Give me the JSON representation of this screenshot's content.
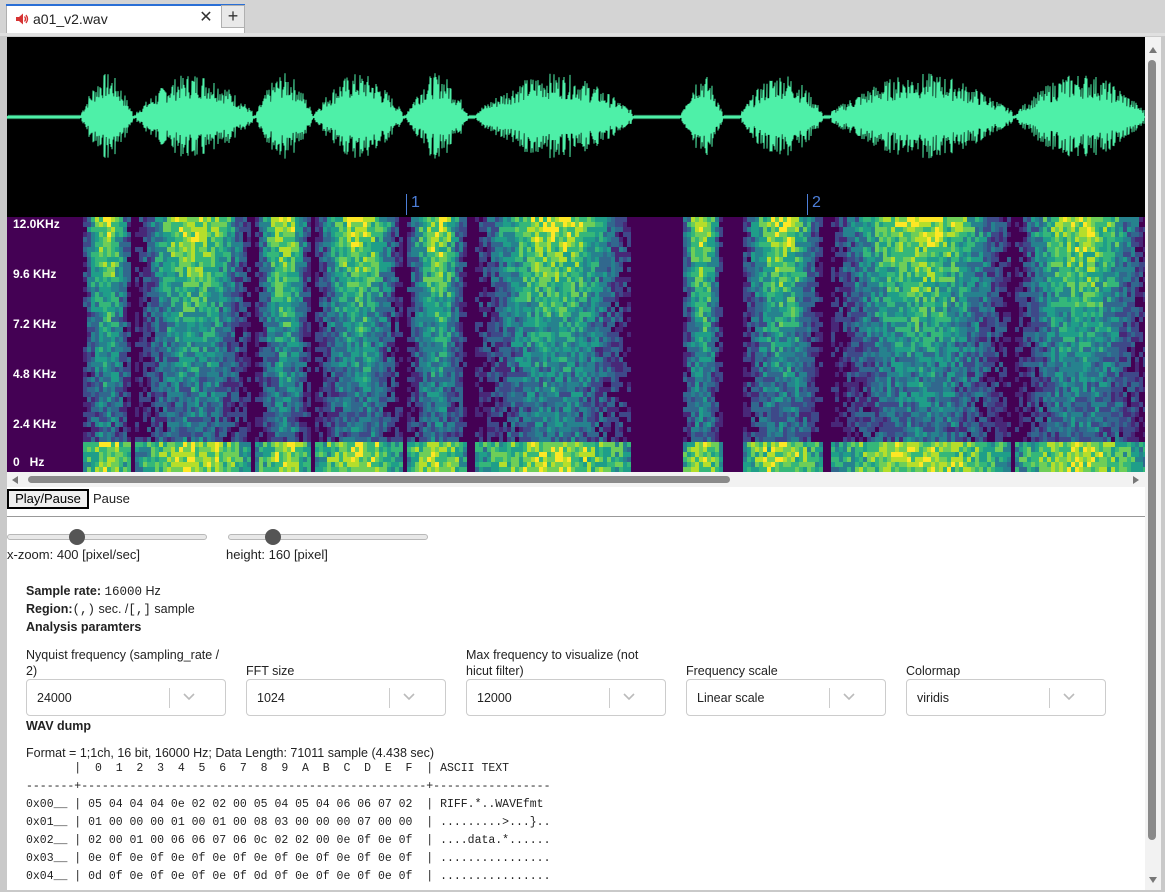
{
  "tab": {
    "title": "a01_v2.wav",
    "close": "✕",
    "new_tab": "+"
  },
  "wave": {
    "markers": [
      "1",
      "2"
    ],
    "color": "#4ef0a8"
  },
  "spectrogram": {
    "freq_labels": [
      "12.0KHz",
      "9.6 KHz",
      "7.2 KHz",
      "4.8 KHz",
      "2.4 KHz",
      "0   Hz"
    ],
    "colormap": "viridis"
  },
  "controls": {
    "play_pause": "Play/Pause",
    "status": "Pause",
    "xzoom_label": "x-zoom: 400 [pixel/sec]",
    "height_label": "height: 160 [pixel]",
    "xzoom_value": 400,
    "height_value": 160
  },
  "info": {
    "sample_rate_label": "Sample rate:",
    "sample_rate_value": "16000",
    "sample_rate_unit": "Hz",
    "region_label": "Region:",
    "region_sec": "(,)",
    "region_sec_unit": "sec. /",
    "region_sample": "[,]",
    "region_sample_unit": "sample",
    "analysis_heading": "Analysis paramters"
  },
  "params": [
    {
      "label": "Nyquist frequency (sampling_rate / 2)",
      "value": "24000"
    },
    {
      "label": "FFT size",
      "value": "1024"
    },
    {
      "label": "Max frequency to visualize (not hicut filter)",
      "value": "12000"
    },
    {
      "label": "Frequency scale",
      "value": "Linear scale"
    },
    {
      "label": "Colormap",
      "value": "viridis"
    }
  ],
  "dump": {
    "heading": "WAV dump",
    "format": "Format = 1;1ch, 16 bit, 16000 Hz; Data Length: 71011 sample (4.438 sec)",
    "header_row": "       |  0  1  2  3  4  5  6  7  8  9  A  B  C  D  E  F  | ASCII TEXT",
    "separator": "-------+--------------------------------------------------+-----------------",
    "rows": [
      "0x00__ | 05 04 04 04 0e 02 02 00 05 04 05 04 06 06 07 02  | RIFF.*..WAVEfmt",
      "0x01__ | 01 00 00 00 01 00 01 00 08 03 00 00 00 07 00 00  | .........>...}..",
      "0x02__ | 02 00 01 00 06 06 07 06 0c 02 02 00 0e 0f 0e 0f  | ....data.*......",
      "0x03__ | 0e 0f 0e 0f 0e 0f 0e 0f 0e 0f 0e 0f 0e 0f 0e 0f  | ................",
      "0x04__ | 0d 0f 0e 0f 0e 0f 0e 0f 0d 0f 0e 0f 0e 0f 0e 0f  | ................"
    ]
  }
}
